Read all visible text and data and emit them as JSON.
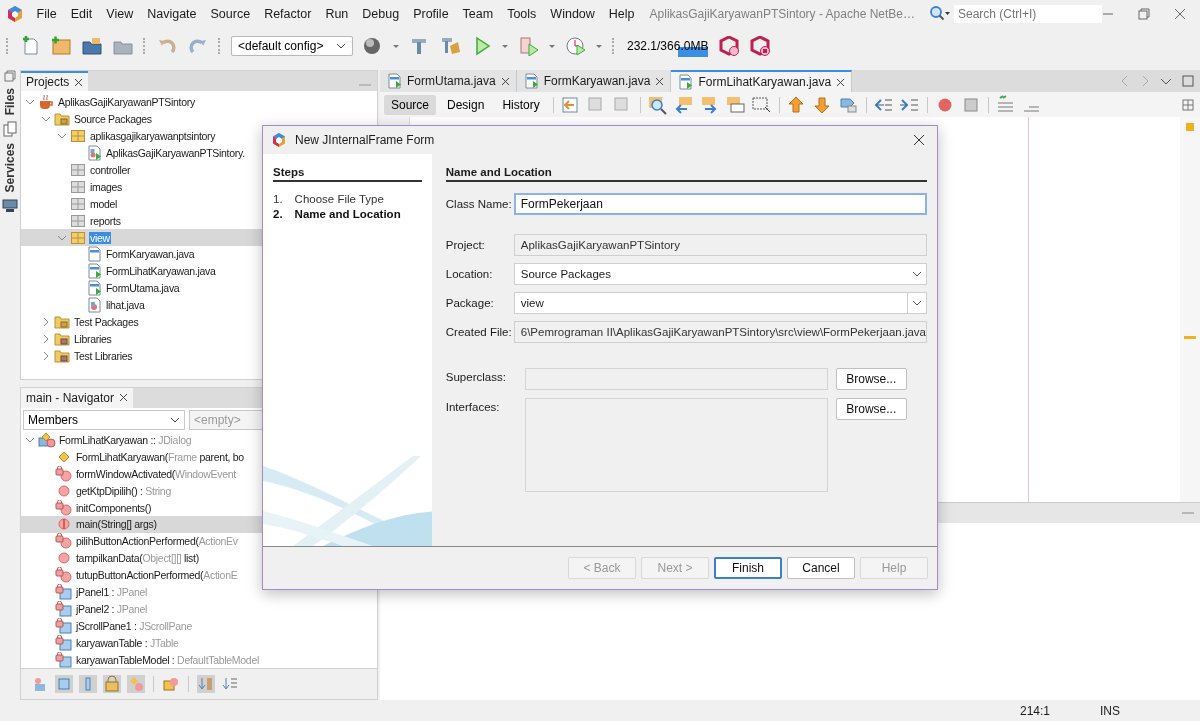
{
  "menu_bar": {
    "items": [
      "File",
      "Edit",
      "View",
      "Navigate",
      "Source",
      "Refactor",
      "Run",
      "Debug",
      "Profile",
      "Team",
      "Tools",
      "Window",
      "Help"
    ],
    "title": "AplikasGajiKaryawanPTSintory - Apache NetBe…",
    "search": {
      "placeholder": "Search (Ctrl+I)"
    }
  },
  "toolbar": {
    "config": "<default config>",
    "memory": "232.1/366.0MB"
  },
  "side_tabs": [
    {
      "label": "Files"
    },
    {
      "label": "Services"
    }
  ],
  "projects": {
    "tab": "Projects",
    "tree": [
      {
        "label": "AplikasGajiKaryawanPTSintory",
        "kind": "project",
        "expanded": true,
        "selected": false,
        "children": [
          {
            "label": "Source Packages",
            "kind": "source-folder",
            "expanded": true,
            "selected": false,
            "children": [
              {
                "label": "aplikasgajikaryawanptsintory",
                "kind": "package",
                "expanded": true,
                "selected": false,
                "children": [
                  {
                    "label": "AplikasGajiKaryawanPTSintory.",
                    "kind": "main-class",
                    "selected": false
                  }
                ]
              },
              {
                "label": "controller",
                "kind": "empty-package",
                "selected": false
              },
              {
                "label": "images",
                "kind": "empty-package",
                "selected": false
              },
              {
                "label": "model",
                "kind": "empty-package",
                "selected": false
              },
              {
                "label": "reports",
                "kind": "empty-package",
                "selected": false
              },
              {
                "label": "view",
                "kind": "package",
                "expanded": true,
                "selected": true,
                "children": [
                  {
                    "label": "FormKaryawan.java",
                    "kind": "form-file",
                    "selected": false
                  },
                  {
                    "label": "FormLihatKaryawan.java",
                    "kind": "form-run",
                    "selected": false
                  },
                  {
                    "label": "FormUtama.java",
                    "kind": "form-run",
                    "selected": false
                  },
                  {
                    "label": "lihat.java",
                    "kind": "class-file",
                    "selected": false
                  }
                ]
              }
            ]
          },
          {
            "label": "Test Packages",
            "kind": "source-folder",
            "expanded": false,
            "selected": false
          },
          {
            "label": "Libraries",
            "kind": "library-folder",
            "expanded": false,
            "selected": false
          },
          {
            "label": "Test Libraries",
            "kind": "library-folder",
            "expanded": false,
            "selected": false
          }
        ]
      }
    ]
  },
  "navigator": {
    "tab": "main - Navigator",
    "filter": "Members",
    "scope": "<empty>",
    "tree": [
      {
        "kind": "class",
        "expanded": true,
        "selected": false,
        "parts": [
          {
            "text": "FormLihatKaryawan ::"
          },
          {
            "text": " JDialog",
            "dim": true
          }
        ],
        "children": [
          {
            "kind": "constructor",
            "selected": false,
            "parts": [
              {
                "text": "FormLihatKaryawan("
              },
              {
                "text": "Frame",
                "dim": true
              },
              {
                "text": " parent, bo"
              }
            ]
          },
          {
            "kind": "private-method",
            "selected": false,
            "parts": [
              {
                "text": "formWindowActivated("
              },
              {
                "text": "WindowEvent",
                "dim": true
              }
            ]
          },
          {
            "kind": "method",
            "selected": false,
            "parts": [
              {
                "text": "getKtpDipilih() :"
              },
              {
                "text": " String",
                "dim": true
              }
            ]
          },
          {
            "kind": "private-method",
            "selected": false,
            "parts": [
              {
                "text": "initComponents()"
              }
            ]
          },
          {
            "kind": "static-method",
            "selected": true,
            "parts": [
              {
                "text": "main(String[] args)"
              }
            ]
          },
          {
            "kind": "private-method",
            "selected": false,
            "parts": [
              {
                "text": "pilihButtonActionPerformed("
              },
              {
                "text": "ActionEv",
                "dim": true
              }
            ]
          },
          {
            "kind": "method",
            "selected": false,
            "parts": [
              {
                "text": "tampilkanData("
              },
              {
                "text": "Object[][]",
                "dim": true
              },
              {
                "text": " list)"
              }
            ]
          },
          {
            "kind": "private-method",
            "selected": false,
            "parts": [
              {
                "text": "tutupButtonActionPerformed("
              },
              {
                "text": "ActionE",
                "dim": true
              }
            ]
          },
          {
            "kind": "private-field",
            "selected": false,
            "parts": [
              {
                "text": "jPanel1 :"
              },
              {
                "text": " JPanel",
                "dim": true
              }
            ]
          },
          {
            "kind": "private-field",
            "selected": false,
            "parts": [
              {
                "text": "jPanel2 :"
              },
              {
                "text": " JPanel",
                "dim": true
              }
            ]
          },
          {
            "kind": "private-field",
            "selected": false,
            "parts": [
              {
                "text": "jScrollPane1 :"
              },
              {
                "text": " JScrollPane",
                "dim": true
              }
            ]
          },
          {
            "kind": "private-field",
            "selected": false,
            "parts": [
              {
                "text": "karyawanTable :"
              },
              {
                "text": " JTable",
                "dim": true
              }
            ]
          },
          {
            "kind": "private-field",
            "selected": false,
            "parts": [
              {
                "text": "karyawanTableModel :"
              },
              {
                "text": " DefaultTableModel",
                "dim": true
              }
            ]
          }
        ]
      }
    ]
  },
  "editor": {
    "tabs": [
      {
        "label": "FormUtama.java",
        "selected": false
      },
      {
        "label": "FormKaryawan.java",
        "selected": false
      },
      {
        "label": "FormLihatKaryawan.java",
        "selected": true
      }
    ],
    "views": [
      {
        "label": "Source",
        "selected": true
      },
      {
        "label": "Design",
        "selected": false
      },
      {
        "label": "History",
        "selected": false
      }
    ]
  },
  "status_bar": {
    "position": "214:1",
    "mode": "INS"
  },
  "dialog": {
    "title": "New JInternalFrame Form",
    "steps_heading": "Steps",
    "steps": [
      {
        "number": "1.",
        "label": "Choose File Type",
        "selected": false
      },
      {
        "number": "2.",
        "label": "Name and Location",
        "selected": true
      }
    ],
    "heading": "Name and Location",
    "fields": [
      {
        "label": "Class Name:",
        "value": "FormPekerjaan",
        "kind": "text"
      },
      {
        "label": "Project:",
        "value": "AplikasGajiKaryawanPTSintory",
        "kind": "readonly"
      },
      {
        "label": "Location:",
        "value": "Source Packages",
        "kind": "dropdown"
      },
      {
        "label": "Package:",
        "value": "view",
        "kind": "combo"
      },
      {
        "label": "Created File:",
        "value": "6\\Pemrograman II\\AplikasGajiKaryawanPTSintory\\src\\view\\FormPekerjaan.java",
        "kind": "readonly"
      }
    ],
    "superclass": {
      "label": "Superclass:",
      "button": "Browse..."
    },
    "interfaces": {
      "label": "Interfaces:",
      "button": "Browse..."
    },
    "buttons": [
      {
        "label": "< Back",
        "disabled": true,
        "focused": false
      },
      {
        "label": "Next >",
        "disabled": true,
        "focused": false
      },
      {
        "label": "Finish",
        "disabled": false,
        "focused": true
      },
      {
        "label": "Cancel",
        "disabled": false,
        "focused": false
      },
      {
        "label": "Help",
        "disabled": true,
        "focused": false
      }
    ]
  }
}
